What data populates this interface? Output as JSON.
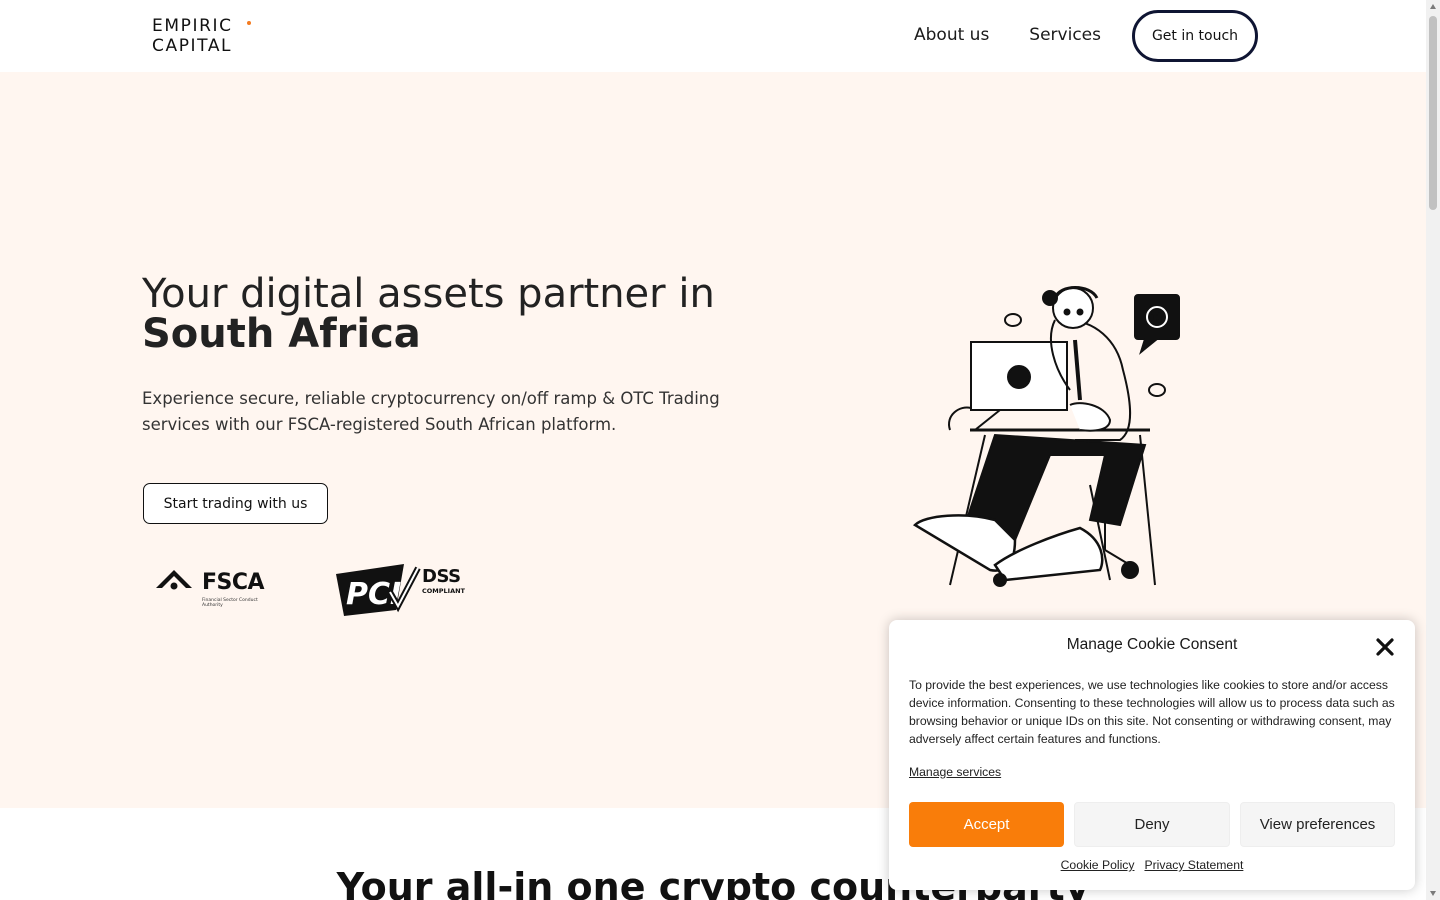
{
  "header": {
    "logo_line1": "EMPIRIC",
    "logo_line2": "CAPITAL",
    "nav": [
      "About us",
      "Services"
    ],
    "cta_label": "Get in touch",
    "accent_color": "#f47b20"
  },
  "hero": {
    "title_regular": "Your digital assets partner in ",
    "title_bold": "South Africa",
    "description": "Experience secure, reliable cryptocurrency on/off ramp & OTC Trading services with our FSCA-registered South African platform.",
    "button_label": "Start trading with us",
    "badges": {
      "fsca_name": "FSCA",
      "fsca_sub": "Financial Sector Conduct Authority",
      "pci_dss": "DSS",
      "pci_compliant": "COMPLIANT"
    },
    "background_color": "#fff6f0"
  },
  "section2": {
    "title_pre": "Your ",
    "title_bold": "all-in one",
    "title_post": " crypto counterparty"
  },
  "cookie": {
    "title": "Manage Cookie Consent",
    "text": "To provide the best experiences, we use technologies like cookies to store and/or access device information. Consenting to these technologies will allow us to process data such as browsing behavior or unique IDs on this site. Not consenting or withdrawing consent, may adversely affect certain features and functions.",
    "manage_services": "Manage services",
    "accept_label": "Accept",
    "deny_label": "Deny",
    "preferences_label": "View preferences",
    "links": [
      "Cookie Policy",
      "Privacy Statement"
    ],
    "accept_color": "#f97d0a"
  }
}
